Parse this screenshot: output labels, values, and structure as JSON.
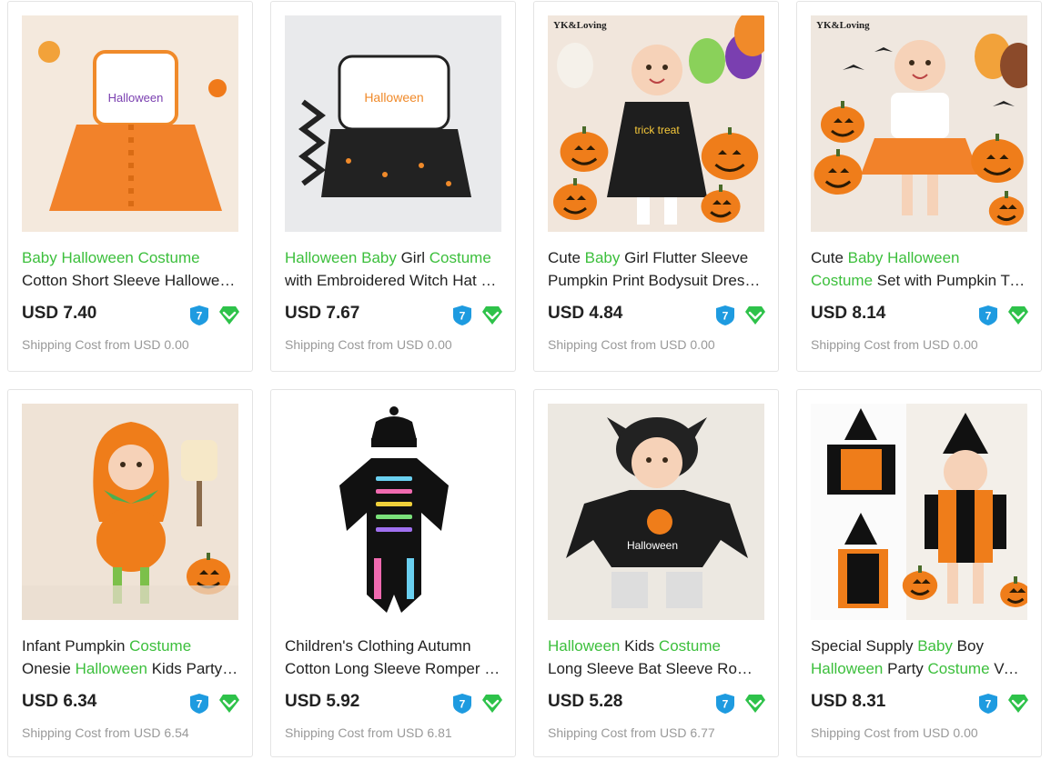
{
  "products": [
    {
      "title_line1": [
        {
          "t": "Baby Halloween Costume",
          "kw": true
        }
      ],
      "title_line2": [
        {
          "t": "Cotton Short Sleeve Halloween Romper Tutu Skirt Set",
          "kw": false
        }
      ],
      "price": "USD 7.40",
      "shipping": "Shipping Cost from USD 0.00",
      "brand_mark": "",
      "image_desc": "orange-tutu-romper"
    },
    {
      "title_line1": [
        {
          "t": "Halloween ",
          "kw": true
        },
        {
          "t": "Baby",
          "kw": true
        },
        {
          "t": " Girl ",
          "kw": false
        },
        {
          "t": "Costume",
          "kw": true
        }
      ],
      "title_line2": [
        {
          "t": "with Embroidered Witch Hat Romper Dress Set",
          "kw": false
        }
      ],
      "price": "USD 7.67",
      "shipping": "Shipping Cost from USD 0.00",
      "brand_mark": "",
      "image_desc": "witch-romper-set"
    },
    {
      "title_line1": [
        {
          "t": "Cute ",
          "kw": false
        },
        {
          "t": "Baby",
          "kw": true
        },
        {
          "t": " Girl Flutter Sleeve",
          "kw": false
        }
      ],
      "title_line2": [
        {
          "t": "Pumpkin Print Bodysuit Dress Halloween",
          "kw": false
        }
      ],
      "price": "USD 4.84",
      "shipping": "Shipping Cost from USD 0.00",
      "brand_mark": "YK&Loving",
      "image_desc": "trick-or-treat-dress"
    },
    {
      "title_line1": [
        {
          "t": "Cute ",
          "kw": false
        },
        {
          "t": "Baby Halloween",
          "kw": true
        }
      ],
      "title_line2": [
        {
          "t": "Costume",
          "kw": true
        },
        {
          "t": " Set with Pumpkin Tutu Skirt",
          "kw": false
        }
      ],
      "price": "USD 8.14",
      "shipping": "Shipping Cost from USD 0.00",
      "brand_mark": "YK&Loving",
      "image_desc": "pumpkin-tutu-set"
    },
    {
      "title_line1": [
        {
          "t": "Infant Pumpkin ",
          "kw": false
        },
        {
          "t": "Costume",
          "kw": true
        }
      ],
      "title_line2": [
        {
          "t": "Onesie ",
          "kw": false
        },
        {
          "t": "Halloween",
          "kw": true
        },
        {
          "t": " Kids Party Hooded Romper",
          "kw": false
        }
      ],
      "price": "USD 6.34",
      "shipping": "Shipping Cost from USD 6.54",
      "brand_mark": "",
      "image_desc": "pumpkin-onesie"
    },
    {
      "title_line1": [
        {
          "t": "Children's Clothing Autumn",
          "kw": false
        }
      ],
      "title_line2": [
        {
          "t": "Cotton Long Sleeve Romper Skeleton Print",
          "kw": false
        }
      ],
      "price": "USD 5.92",
      "shipping": "Shipping Cost from USD 6.81",
      "brand_mark": "",
      "image_desc": "skeleton-romper"
    },
    {
      "title_line1": [
        {
          "t": "Halloween",
          "kw": true
        },
        {
          "t": " Kids ",
          "kw": false
        },
        {
          "t": "Costume",
          "kw": true
        }
      ],
      "title_line2": [
        {
          "t": "Long Sleeve Bat Sleeve Romper with Hat",
          "kw": false
        }
      ],
      "price": "USD 5.28",
      "shipping": "Shipping Cost from USD 6.77",
      "brand_mark": "",
      "image_desc": "bat-romper"
    },
    {
      "title_line1": [
        {
          "t": "Special Supply ",
          "kw": false
        },
        {
          "t": "Baby",
          "kw": true
        },
        {
          "t": " Boy",
          "kw": false
        }
      ],
      "title_line2": [
        {
          "t": "Halloween",
          "kw": true
        },
        {
          "t": " Party ",
          "kw": false
        },
        {
          "t": "Costume",
          "kw": true
        },
        {
          "t": " Vest Romper Set",
          "kw": false
        }
      ],
      "price": "USD 8.31",
      "shipping": "Shipping Cost from USD 0.00",
      "brand_mark": "",
      "image_desc": "wizard-vest-romper"
    }
  ],
  "badges": {
    "seven_day": "7",
    "diamond": "diamond-icon"
  },
  "colors": {
    "keyword": "#3cbf3c",
    "price": "#222222",
    "shipping": "#999999",
    "badge_blue": "#1e9be0",
    "badge_green": "#2ec24a"
  }
}
